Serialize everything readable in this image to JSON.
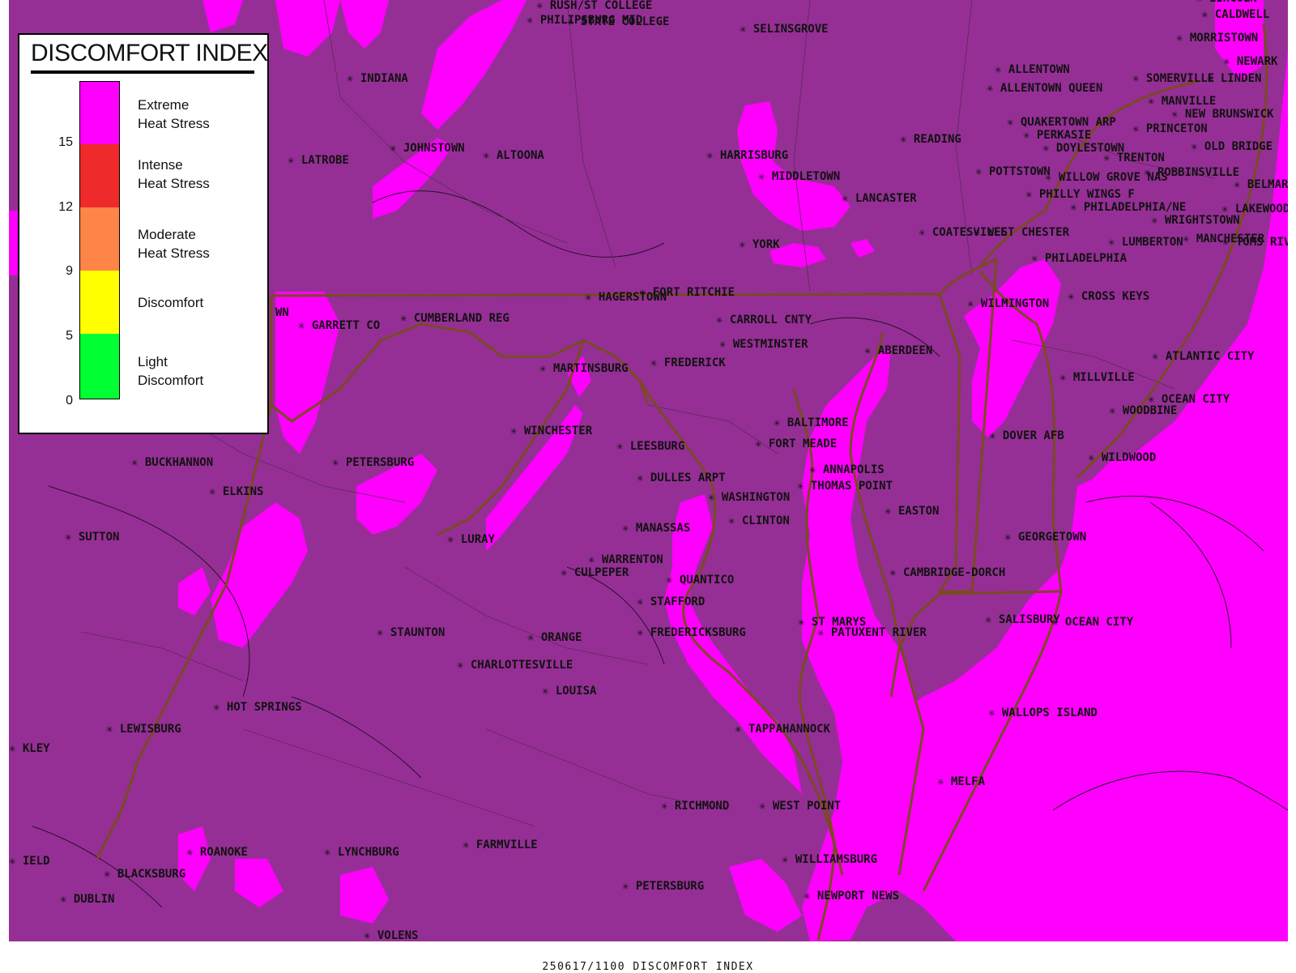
{
  "colors": {
    "map_base": "#952f95",
    "extreme": "#ff00ff",
    "intense": "#ee2a2a",
    "moderate": "#ff8447",
    "discomfort": "#ffff00",
    "light": "#00ff33",
    "borders": "#7a4a23",
    "background": "#ffffff"
  },
  "legend": {
    "title": "DISCOMFORT INDEX",
    "categories": [
      {
        "line1": "Extreme",
        "line2": "Heat Stress",
        "color": "#ff00ff"
      },
      {
        "line1": "Intense",
        "line2": "Heat Stress",
        "color": "#ee2a2a"
      },
      {
        "line1": "Moderate",
        "line2": "Heat Stress",
        "color": "#ff8447"
      },
      {
        "line1": "Discomfort",
        "line2": "",
        "color": "#ffff00"
      },
      {
        "line1": "Light",
        "line2": "Discomfort",
        "color": "#00ff33"
      }
    ],
    "ticks": [
      "15",
      "12",
      "9",
      "5",
      "0"
    ]
  },
  "footer": "250617/1100 DISCOMFORT INDEX",
  "stations": [
    {
      "name": "RUSH/ST COLLEGE"
    },
    {
      "name": "PHILIPSBURG MID"
    },
    {
      "name": "STATE COLLEGE"
    },
    {
      "name": "SELINSGROVE"
    },
    {
      "name": "LINCOLN"
    },
    {
      "name": "CALDWELL"
    },
    {
      "name": "MORRISTOWN"
    },
    {
      "name": "NEWARK"
    },
    {
      "name": "INDIANA"
    },
    {
      "name": "ALLENTOWN"
    },
    {
      "name": "SOMERVILLE"
    },
    {
      "name": "LINDEN"
    },
    {
      "name": "ALLENTOWN QUEEN"
    },
    {
      "name": "MANVILLE"
    },
    {
      "name": "NEW BRUNSWICK"
    },
    {
      "name": "QUAKERTOWN ARP"
    },
    {
      "name": "PRINCETON"
    },
    {
      "name": "PERKASIE"
    },
    {
      "name": "READING"
    },
    {
      "name": "DOYLESTOWN"
    },
    {
      "name": "OLD BRIDGE"
    },
    {
      "name": "JOHNSTOWN"
    },
    {
      "name": "ALTOONA"
    },
    {
      "name": "HARRISBURG"
    },
    {
      "name": "TRENTON"
    },
    {
      "name": "LATROBE"
    },
    {
      "name": "POTTSTOWN"
    },
    {
      "name": "WILLOW GROVE NAS"
    },
    {
      "name": "ROBBINSVILLE"
    },
    {
      "name": "MIDDLETOWN"
    },
    {
      "name": "BELMAR"
    },
    {
      "name": "PHILLY WINGS F"
    },
    {
      "name": "LANCASTER"
    },
    {
      "name": "PHILADELPHIA/NE"
    },
    {
      "name": "LAKEWOOD"
    },
    {
      "name": "WRIGHTSTOWN"
    },
    {
      "name": "COATESVILLE"
    },
    {
      "name": "WEST CHESTER"
    },
    {
      "name": "MANCHESTER"
    },
    {
      "name": "TOMS RIVER"
    },
    {
      "name": "LUMBERTON"
    },
    {
      "name": "YORK"
    },
    {
      "name": "PHILADELPHIA"
    },
    {
      "name": "HAGERSTOWN"
    },
    {
      "name": "FORT RITCHIE"
    },
    {
      "name": "CROSS KEYS"
    },
    {
      "name": "CARROLL CNTY"
    },
    {
      "name": "WILMINGTON"
    },
    {
      "name": "CUMBERLAND REG"
    },
    {
      "name": "GARRETT CO"
    },
    {
      "name": "WESTMINSTER"
    },
    {
      "name": "ABERDEEN"
    },
    {
      "name": "ATLANTIC CITY"
    },
    {
      "name": "FREDERICK"
    },
    {
      "name": "MARTINSBURG"
    },
    {
      "name": "MILLVILLE"
    },
    {
      "name": "OCEAN CITY"
    },
    {
      "name": "WOODBINE"
    },
    {
      "name": "BALTIMORE"
    },
    {
      "name": "WINCHESTER"
    },
    {
      "name": "DOVER AFB"
    },
    {
      "name": "FORT MEADE"
    },
    {
      "name": "LEESBURG"
    },
    {
      "name": "WILDWOOD"
    },
    {
      "name": "BUCKHANNON"
    },
    {
      "name": "PETERSBURG"
    },
    {
      "name": "ANNAPOLIS"
    },
    {
      "name": "DULLES ARPT"
    },
    {
      "name": "THOMAS POINT"
    },
    {
      "name": "ELKINS"
    },
    {
      "name": "WASHINGTON"
    },
    {
      "name": "EASTON"
    },
    {
      "name": "CLINTON"
    },
    {
      "name": "MANASSAS"
    },
    {
      "name": "SUTTON"
    },
    {
      "name": "LURAY"
    },
    {
      "name": "GEORGETOWN"
    },
    {
      "name": "WARRENTON"
    },
    {
      "name": "CULPEPER"
    },
    {
      "name": "CAMBRIDGE-DORCH"
    },
    {
      "name": "QUANTICO"
    },
    {
      "name": "STAFFORD"
    },
    {
      "name": "ST MARYS"
    },
    {
      "name": "SALISBURY"
    },
    {
      "name": "OCEAN CITY"
    },
    {
      "name": "STAUNTON"
    },
    {
      "name": "FREDERICKSBURG"
    },
    {
      "name": "PATUXENT RIVER"
    },
    {
      "name": "ORANGE"
    },
    {
      "name": "CHARLOTTESVILLE"
    },
    {
      "name": "LOUISA"
    },
    {
      "name": "HOT SPRINGS"
    },
    {
      "name": "WALLOPS ISLAND"
    },
    {
      "name": "LEWISBURG"
    },
    {
      "name": "TAPPAHANNOCK"
    },
    {
      "name": "MELFA"
    },
    {
      "name": "RICHMOND"
    },
    {
      "name": "WEST POINT"
    },
    {
      "name": "FARMVILLE"
    },
    {
      "name": "ROANOKE"
    },
    {
      "name": "LYNCHBURG"
    },
    {
      "name": "WILLIAMSBURG"
    },
    {
      "name": "BLACKSBURG"
    },
    {
      "name": "PETERSBURG"
    },
    {
      "name": "NEWPORT NEWS"
    },
    {
      "name": "DUBLIN"
    },
    {
      "name": "VOLENS"
    },
    {
      "name": "WN"
    },
    {
      "name": "KLEY"
    },
    {
      "name": "IELD"
    }
  ]
}
